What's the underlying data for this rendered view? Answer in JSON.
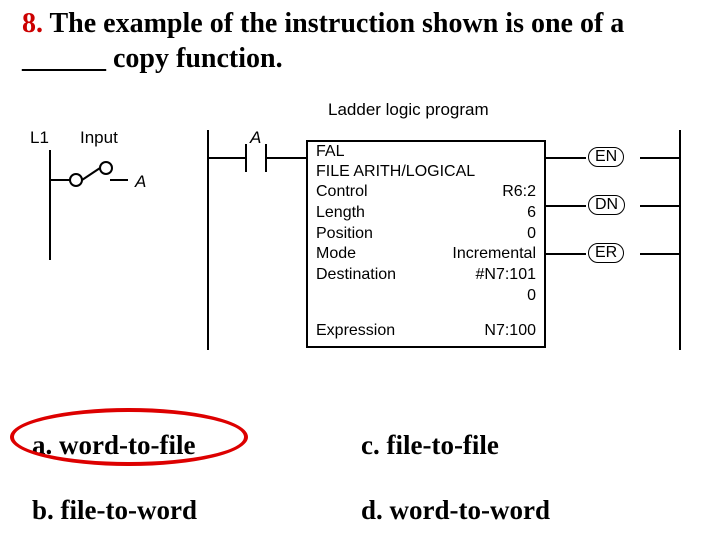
{
  "question": {
    "number": "8.",
    "text_before": " The example of the instruction shown is one of a ",
    "blank": "______",
    "text_after": " copy function."
  },
  "diagram": {
    "title": "Ladder logic program",
    "input_label": "Input",
    "rail_left_label": "L1",
    "contact_label": "A",
    "switch_label": "A",
    "outputs": {
      "en": "EN",
      "dn": "DN",
      "er": "ER"
    }
  },
  "fal": {
    "abbr": "FAL",
    "title": "FILE ARITH/LOGICAL",
    "rows": [
      {
        "label": "Control",
        "value": "R6:2"
      },
      {
        "label": "Length",
        "value": "6"
      },
      {
        "label": "Position",
        "value": "0"
      },
      {
        "label": "Mode",
        "value": "Incremental"
      },
      {
        "label": "Destination",
        "value": "#N7:101"
      }
    ],
    "dest_extra": "0",
    "expression_label": "Expression",
    "expression_value": "N7:100"
  },
  "options": {
    "a": "a. word-to-file",
    "b": "b. file-to-word",
    "c": "c. file-to-file",
    "d": "d. word-to-word"
  },
  "answer": "a"
}
